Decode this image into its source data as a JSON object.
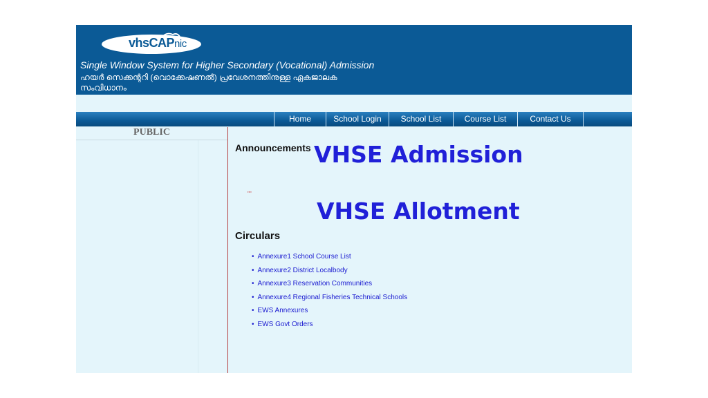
{
  "header": {
    "logo": {
      "vhs": "vhs",
      "cap": "CAP",
      "nic": "nic"
    },
    "tagline_en": "Single Window System for Higher Secondary (Vocational) Admission",
    "tagline_ml": "ഹയർ സെക്കന്ററി (വൊക്കേഷണൽ) പ്രവേശനത്തിനുള്ള ഏകജാലക സംവിധാനം"
  },
  "nav": {
    "items": [
      {
        "label": "Home"
      },
      {
        "label": "School Login"
      },
      {
        "label": "School List"
      },
      {
        "label": "Course List"
      },
      {
        "label": "Contact Us"
      }
    ]
  },
  "sidebar": {
    "title": "PUBLIC"
  },
  "content": {
    "announcements_title": "Announcements",
    "overlay_admission": "VHSE Admission",
    "overlay_allotment": "VHSE Allotment",
    "tiny_mark": "\"\"",
    "circulars_title": "Circulars",
    "circulars": [
      "Annexure1 School Course List",
      "Annexure2 District Localbody",
      "Annexure3 Reservation Communities",
      "Annexure4 Regional Fisheries Technical Schools",
      "EWS Annexures",
      "EWS Govt Orders"
    ]
  },
  "colors": {
    "header_bg": "#0b5a96",
    "page_bg": "#e4f5fb",
    "overlay_text": "#2020d8",
    "link": "#1a1ad0"
  }
}
